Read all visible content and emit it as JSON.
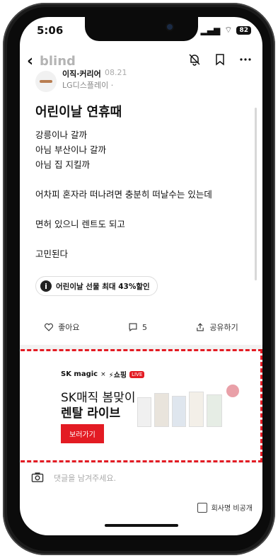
{
  "status": {
    "time": "5:06",
    "battery": "82"
  },
  "nav": {
    "back_icon": "chevron-left-icon",
    "brand": "blind"
  },
  "author": {
    "name": "이직·커리어",
    "date": "08.21",
    "company": "LG디스플레이 ·"
  },
  "post": {
    "title": "어린이날 연휴때",
    "body": [
      "강릉이나 갈까",
      "아님 부산이나 갈까",
      "아님 집 지킬까",
      "",
      "어차피 혼자라 떠나려면 충분히 떠날수는 있는데",
      "",
      "면허 있으니 렌트도 되고",
      "",
      "고민된다"
    ]
  },
  "promo": {
    "icon": "i",
    "text": "어린이날 선물 최대 43%할인"
  },
  "actions": {
    "like": "좋아요",
    "comments": "5",
    "share": "공유하기"
  },
  "ad": {
    "brand_sk": "SK magic",
    "times": "×",
    "brand_shop": "⚡쇼핑",
    "live": "LIVE",
    "line1": "SK매직 봄맞이",
    "line2": "렌탈 라이브",
    "cta": "보러가기",
    "highlight_color": "#e31b23"
  },
  "comment": {
    "placeholder": "댓글을 남겨주세요."
  },
  "anonymous": {
    "label": "회사명 비공개"
  }
}
